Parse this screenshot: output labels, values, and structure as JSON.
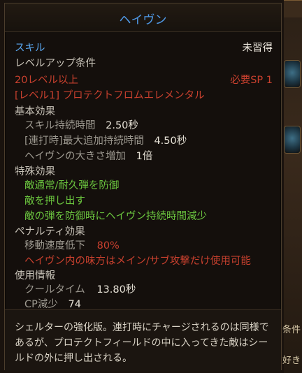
{
  "title": "ヘイヴン",
  "type_label": "スキル",
  "status": "未習得",
  "levelup_heading": "レベルアップ条件",
  "req_level": "20レベル以上",
  "req_sp": "必要SP 1",
  "prereq": "[レベル1] プロテクトフロムエレメンタル",
  "basic": {
    "heading": "基本効果",
    "stats": [
      {
        "label": "スキル持続時間",
        "value": "2.50秒"
      },
      {
        "label": "[連打時]最大追加持続時間",
        "value": "4.50秒"
      },
      {
        "label": "ヘイヴンの大きさ増加",
        "value": "1倍"
      }
    ]
  },
  "special": {
    "heading": "特殊効果",
    "items": [
      "敵通常/耐久弾を防御",
      "敵を押し出す",
      "敵の弾を防御時にヘイヴン持続時間減少"
    ]
  },
  "penalty": {
    "heading": "ペナルティ効果",
    "speed_label": "移動速度低下",
    "speed_value": "80%",
    "note": "ヘイヴン内の味方はメイン/サブ攻撃だけ使用可能"
  },
  "usage": {
    "heading": "使用情報",
    "cooldown_label": "クールタイム",
    "cooldown_value": "13.80秒",
    "cp_label": "CP減少",
    "cp_value": "74"
  },
  "description": "シェルターの強化版。連打時にチャージされるのは同様であるが、プロテクトフィールドの中に入ってきた敵はシールドの外に押し出される。",
  "background_fragments": {
    "side_text_1": "条件",
    "side_text_2": "好き"
  },
  "colors": {
    "title": "#4f9ae8",
    "requirement": "#c8402e",
    "special_effect": "#6ac43e"
  }
}
